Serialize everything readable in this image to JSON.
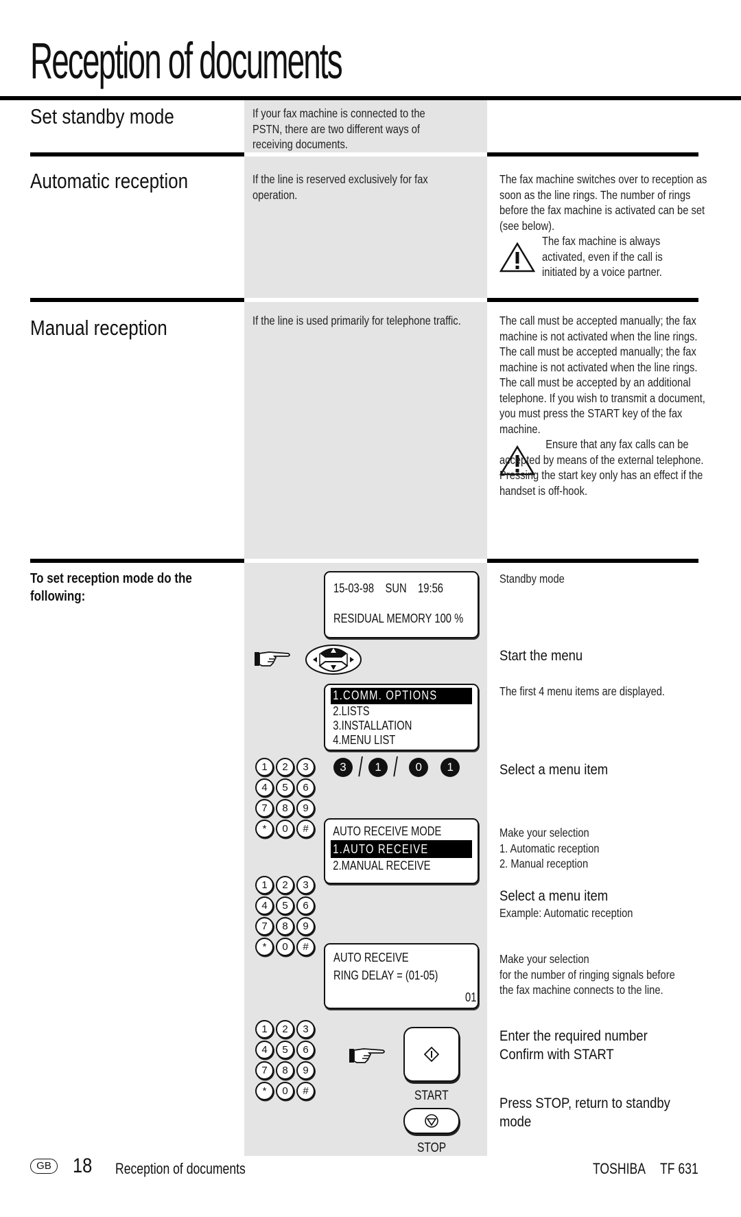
{
  "page": {
    "title": "Reception of documents"
  },
  "sections": {
    "standby": {
      "heading": "Set standby mode",
      "middle": "If your fax machine is connected to the PSTN, there are two different ways of receiving documents."
    },
    "automatic": {
      "heading": "Automatic reception",
      "middle": "If the line is reserved exclusively for fax operation.",
      "right": "The fax machine switches over to reception as soon as the line rings. The number of rings before the fax machine is activated can be set (see below).",
      "warning": "The fax machine is always activated, even if the call is initiated by a voice partner."
    },
    "manual": {
      "heading": "Manual reception",
      "middle": "If the line is used primarily for telephone traffic.",
      "right": "The call must be accepted manually; the fax machine is not activated when the line rings. The call must be accepted manually; the fax machine is not activated when the line rings. The call must be accepted by an additional telephone. If you wish to transmit a document, you must press the START key of the fax machine.",
      "warning": "Ensure that any fax calls can be accepted by means of the external telephone. Pressing the start key only has an effect if the handset is off-hook."
    }
  },
  "procedure": {
    "heading": "To set reception mode do the following:",
    "lcd_standby": {
      "line1": "15-03-98    SUN    19:56",
      "line2": "RESIDUAL MEMORY 100 %"
    },
    "lcd_menu": {
      "items": [
        "1.COMM. OPTIONS",
        "2.LISTS",
        "3.INSTALLATION",
        "4.MENU LIST"
      ],
      "selected": 0
    },
    "key_sequence": [
      "3",
      "/",
      "1",
      "/",
      "0",
      "1"
    ],
    "lcd_mode": {
      "title": "AUTO RECEIVE MODE",
      "items": [
        "1.AUTO RECEIVE",
        "2.MANUAL RECEIVE"
      ],
      "selected": 0
    },
    "lcd_delay": {
      "line1": "AUTO RECEIVE",
      "line2": "RING DELAY = (01-05)",
      "value": "01"
    },
    "keypad_keys": [
      [
        "1",
        "2",
        "3"
      ],
      [
        "4",
        "5",
        "6"
      ],
      [
        "7",
        "8",
        "9"
      ],
      [
        "*",
        "0",
        "#"
      ]
    ],
    "start_label": "START",
    "stop_label": "STOP",
    "steps": {
      "standby": "Standby mode",
      "start_menu": "Start the menu",
      "first_items": "The first 4 menu items are displayed.",
      "select_item": "Select a menu item",
      "make_sel": "Make your selection",
      "opt1": "1. Automatic reception",
      "opt2": "2. Manual reception",
      "select_item2": "Select a menu item",
      "example": "Example: Automatic reception",
      "make_sel2": "Make your selection",
      "ring_l1": "for the number of ringing signals before",
      "ring_l2": "the fax machine connects to the line.",
      "enter_num": "Enter the required number",
      "confirm": "Confirm with START",
      "press_stop_l1": "Press STOP, return to standby",
      "press_stop_l2": "mode"
    }
  },
  "footer": {
    "lang_badge": "GB",
    "page_number": "18",
    "section": "Reception of documents",
    "brand": "TOSHIBA",
    "model": "TF 631"
  }
}
